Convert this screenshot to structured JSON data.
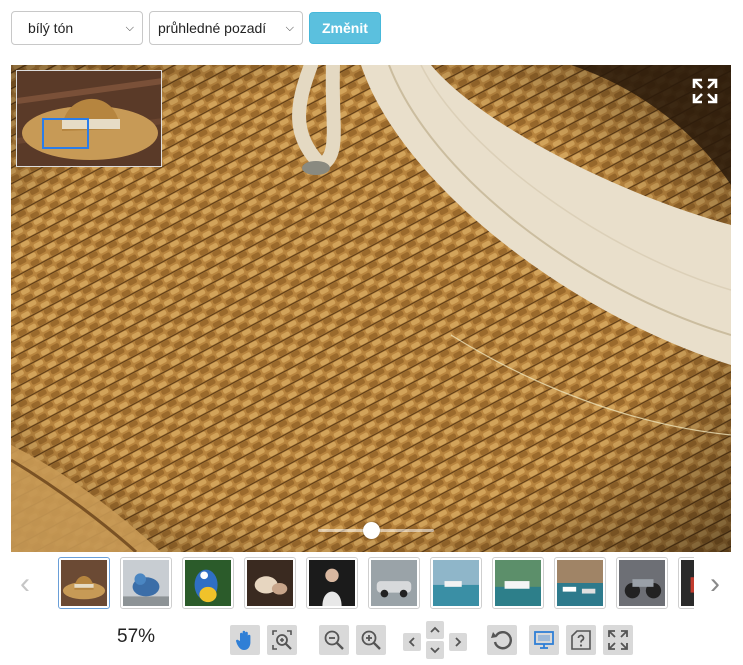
{
  "controls": {
    "tone_select": {
      "selected": "bílý tón"
    },
    "background_select": {
      "selected": "průhledné pozadí"
    },
    "change_button": "Změnit"
  },
  "viewer": {
    "zoom_text": "57%",
    "slider_level": 0.55,
    "thumbnails": [
      {
        "name": "thumb-straw-hat",
        "active": true
      },
      {
        "name": "thumb-blue-bird",
        "active": false
      },
      {
        "name": "thumb-parrot",
        "active": false
      },
      {
        "name": "thumb-shells",
        "active": false
      },
      {
        "name": "thumb-woman",
        "active": false
      },
      {
        "name": "thumb-car",
        "active": false
      },
      {
        "name": "thumb-harbor",
        "active": false
      },
      {
        "name": "thumb-ferry",
        "active": false
      },
      {
        "name": "thumb-boats",
        "active": false
      },
      {
        "name": "thumb-motorbike",
        "active": false
      },
      {
        "name": "thumb-partial",
        "active": false
      }
    ]
  },
  "toolbar": {
    "buttons": [
      "pan-hand-icon",
      "zoom-region-icon",
      "zoom-out-icon",
      "zoom-in-icon",
      "pan-left-icon",
      "pan-up-icon",
      "pan-down-icon",
      "pan-right-icon",
      "reset-icon",
      "fit-screen-icon",
      "help-icon",
      "fullscreen-icon"
    ]
  },
  "colors": {
    "accent_button": "#5bc0de",
    "overview_frame": "#2b7de9",
    "toolbar_button": "#d9d9d9",
    "icon_blue": "#2f7fd6"
  }
}
